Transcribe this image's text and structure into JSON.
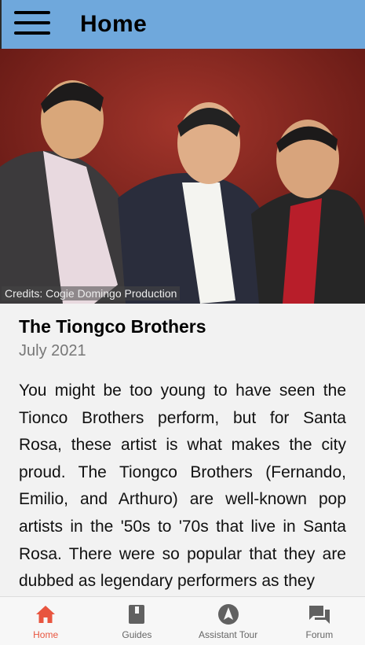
{
  "header": {
    "title": "Home"
  },
  "hero": {
    "credits": "Credits: Cogie Domingo Production"
  },
  "article": {
    "title": "The Tiongco Brothers",
    "date": "July 2021",
    "body": "You might be too young to have seen the Tionco Brothers perform, but for Santa Rosa, these artist is what makes the city proud. The Tiongco Brothers (Fernando, Emilio, and Arthuro) are well-known pop artists in the '50s to '70s that live in Santa Rosa. There were so popular that they are dubbed as legendary performers as they"
  },
  "nav": {
    "items": [
      {
        "label": "Home",
        "icon": "home-icon",
        "active": true
      },
      {
        "label": "Guides",
        "icon": "book-icon",
        "active": false
      },
      {
        "label": "Assistant Tour",
        "icon": "navigation-icon",
        "active": false
      },
      {
        "label": "Forum",
        "icon": "forum-icon",
        "active": false
      }
    ]
  },
  "colors": {
    "header": "#6fa8dc",
    "active": "#e8553f",
    "inactive": "#616161"
  }
}
